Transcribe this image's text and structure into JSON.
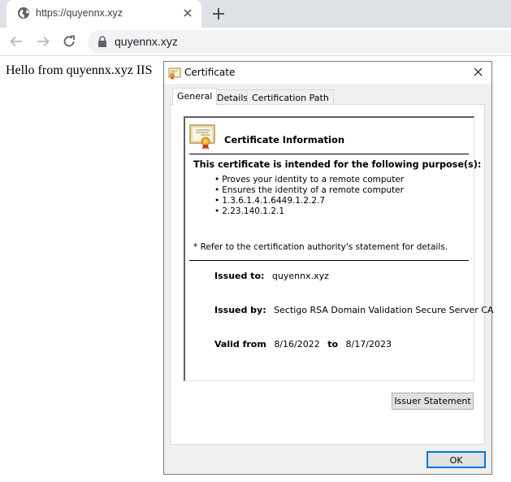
{
  "browser": {
    "tab_title": "https://quyennx.xyz",
    "url": "quyennx.xyz",
    "icons": {
      "favicon": "globe-icon",
      "tab_close": "close-icon",
      "new_tab": "plus-icon",
      "back": "arrow-left-icon",
      "forward": "arrow-right-icon",
      "reload": "reload-icon",
      "lock": "lock-icon"
    }
  },
  "page": {
    "text": "Hello from quyennx.xyz IIS"
  },
  "dialog": {
    "title": "Certificate",
    "tabs": [
      {
        "label": "General",
        "active": true
      },
      {
        "label": "Details",
        "active": false
      },
      {
        "label": "Certification Path",
        "active": false
      }
    ],
    "heading": "Certificate Information",
    "purpose_heading": "This certificate is intended for the following purpose(s):",
    "purposes": [
      "Proves your identity to a remote computer",
      "Ensures the identity of a remote computer",
      "1.3.6.1.4.1.6449.1.2.2.7",
      "2.23.140.1.2.1"
    ],
    "refer_note": "* Refer to the certification authority's statement for details.",
    "issued_to_label": "Issued to:",
    "issued_to": "quyennx.xyz",
    "issued_by_label": "Issued by:",
    "issued_by": "Sectigo RSA Domain Validation Secure Server CA",
    "valid_from_label": "Valid from",
    "valid_from": "8/16/2022",
    "to_label": "to",
    "valid_to": "8/17/2023",
    "issuer_statement_button": "Issuer Statement",
    "ok_button": "OK"
  },
  "colors": {
    "tabstrip_bg": "#dee1e6",
    "omnibox_bg": "#f1f3f4",
    "dialog_bg": "#f0f0f0",
    "ok_border": "#0078d7",
    "button_bg": "#e1e1e1"
  }
}
